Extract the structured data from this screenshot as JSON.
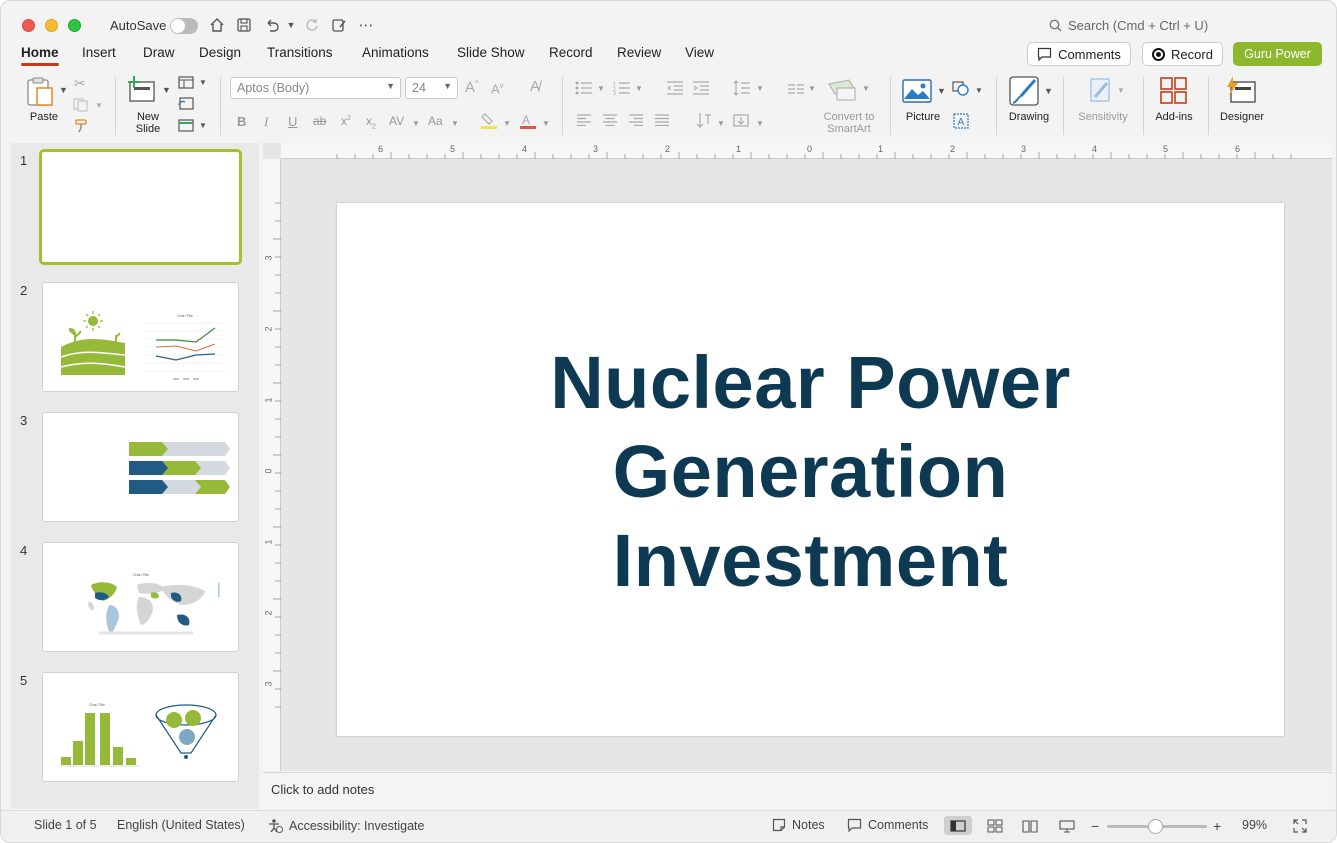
{
  "titlebar": {
    "autosave_label": "AutoSave",
    "search_placeholder": "Search (Cmd + Ctrl + U)"
  },
  "tabs": [
    "Home",
    "Insert",
    "Draw",
    "Design",
    "Transitions",
    "Animations",
    "Slide Show",
    "Record",
    "Review",
    "View"
  ],
  "header_buttons": {
    "comments": "Comments",
    "record": "Record",
    "guru": "Guru Power",
    "guru_color": "#8db82e"
  },
  "ribbon": {
    "paste": "Paste",
    "new_slide_1": "New",
    "new_slide_2": "Slide",
    "font_name": "Aptos (Body)",
    "font_size": "24",
    "convert_1": "Convert to",
    "convert_2": "SmartArt",
    "picture": "Picture",
    "drawing": "Drawing",
    "sensitivity": "Sensitivity",
    "addins": "Add-ins",
    "designer": "Designer"
  },
  "thumbnails": {
    "numbers": [
      "1",
      "2",
      "3",
      "4",
      "5"
    ],
    "chart_title": "Chart Title"
  },
  "ruler": {
    "top": [
      "6",
      "5",
      "4",
      "3",
      "2",
      "1",
      "0",
      "1",
      "2",
      "3",
      "4",
      "5",
      "6"
    ],
    "left": [
      "3",
      "2",
      "1",
      "0",
      "1",
      "2",
      "3"
    ]
  },
  "slide": {
    "title": "Nuclear Power\nGeneration\nInvestment",
    "title_color": "#0d3a52"
  },
  "notes": {
    "placeholder": "Click to add notes"
  },
  "status": {
    "slide_info": "Slide 1 of 5",
    "language": "English (United States)",
    "accessibility": "Accessibility: Investigate",
    "notes": "Notes",
    "comments": "Comments",
    "zoom": "99%"
  }
}
